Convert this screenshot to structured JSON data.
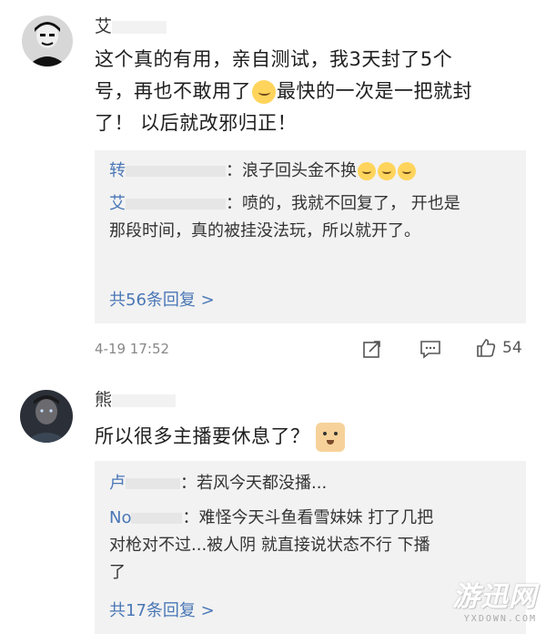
{
  "comment1": {
    "username": "艾",
    "text_line1": "这个真的有用，亲自测试，我3天封了5个",
    "text_line2_a": "号，再也不敢用了",
    "text_line2_b": "最快的一次是一把就封",
    "text_line3": "了！ 以后就改邪归正！",
    "replies": [
      {
        "name": "转",
        "sep": "：",
        "text": "浪子回头金不换"
      },
      {
        "name": "艾",
        "sep": "：",
        "text": "喷的，我就不回复了，  开也是",
        "text2": "那段时间，真的被挂没法玩，所以就开了。"
      }
    ],
    "more_label": "共56条回复 >",
    "timestamp": "4-19 17:52",
    "like_count": "54"
  },
  "comment2": {
    "username": "熊",
    "text": "所以很多主播要休息了？",
    "replies": [
      {
        "name": "卢",
        "sep": "：",
        "text": "若风今天都没播..."
      },
      {
        "name": "No",
        "sep": "：",
        "text": "难怪今天斗鱼看雪妹妹 打了几把",
        "text2": "对枪对不过...被人阴 就直接说状态不行 下播",
        "text3": "了"
      }
    ],
    "more_label": "共17条回复 >"
  },
  "watermark": {
    "main": "游迅网",
    "sub": "YXDOWN.COM"
  },
  "colors": {
    "link": "#4a77b6",
    "reply_bg": "#f2f2f2",
    "meta": "#888888"
  }
}
